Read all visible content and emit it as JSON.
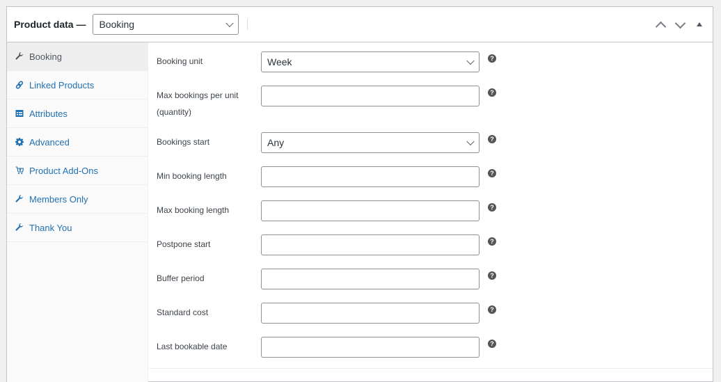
{
  "header": {
    "title": "Product data —",
    "product_type": "Booking",
    "actions": {
      "move_up": "chevron-up-icon",
      "move_down": "chevron-down-icon",
      "toggle": "triangle-up-icon"
    }
  },
  "tabs": [
    {
      "label": "Booking",
      "icon": "wrench-icon",
      "active": true
    },
    {
      "label": "Linked Products",
      "icon": "link-icon",
      "active": false
    },
    {
      "label": "Attributes",
      "icon": "list-view-icon",
      "active": false
    },
    {
      "label": "Advanced",
      "icon": "gear-icon",
      "active": false
    },
    {
      "label": "Product Add-Ons",
      "icon": "cart-icon",
      "active": false
    },
    {
      "label": "Members Only",
      "icon": "wrench-icon",
      "active": false
    },
    {
      "label": "Thank You",
      "icon": "wrench-icon",
      "active": false
    }
  ],
  "fields": [
    {
      "label": "Booking unit",
      "type": "select",
      "value": "Week"
    },
    {
      "label": "Max bookings per unit (quantity)",
      "type": "text",
      "value": ""
    },
    {
      "label": "Bookings start",
      "type": "select",
      "value": "Any"
    },
    {
      "label": "Min booking length",
      "type": "text",
      "value": ""
    },
    {
      "label": "Max booking length",
      "type": "text",
      "value": ""
    },
    {
      "label": "Postpone start",
      "type": "text",
      "value": ""
    },
    {
      "label": "Buffer period",
      "type": "text",
      "value": ""
    },
    {
      "label": "Standard cost",
      "type": "text",
      "value": ""
    },
    {
      "label": "Last bookable date",
      "type": "text",
      "value": ""
    }
  ],
  "help_icon_glyph": "?",
  "colors": {
    "link": "#2271b1",
    "active_tab_bg": "#eeeeee",
    "border": "#c3c4c7"
  }
}
